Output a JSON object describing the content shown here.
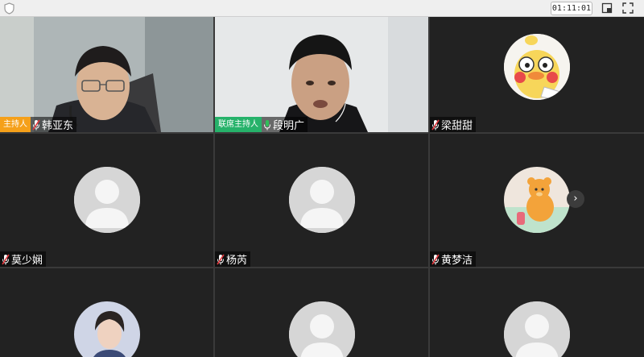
{
  "toolbar": {
    "timer": "01:11:01",
    "icons": [
      "shield-icon",
      "window-mode-icon",
      "fullscreen-icon"
    ]
  },
  "participants": [
    {
      "name": "韩亚东",
      "role": "主持人",
      "video": true,
      "mic": "muted"
    },
    {
      "name": "段明广",
      "role": "联席主持人",
      "video": true,
      "mic": "active",
      "speaking": true
    },
    {
      "name": "梁甜甜",
      "role": "",
      "video": false,
      "avatar": "duck-cartoon-avatar",
      "mic": "muted"
    },
    {
      "name": "莫少娴",
      "role": "",
      "video": false,
      "avatar": "default-avatar",
      "mic": "muted"
    },
    {
      "name": "杨芮",
      "role": "",
      "video": false,
      "avatar": "default-avatar",
      "mic": "muted"
    },
    {
      "name": "黄梦洁",
      "role": "",
      "video": false,
      "avatar": "bear-cartoon-avatar",
      "mic": "muted"
    },
    {
      "name": "",
      "role": "",
      "video": false,
      "avatar": "photo-avatar"
    },
    {
      "name": "",
      "role": "",
      "video": false,
      "avatar": "default-avatar"
    },
    {
      "name": "",
      "role": "",
      "video": false,
      "avatar": "default-avatar"
    }
  ],
  "colors": {
    "host_badge": "#f5a01a",
    "cohost_badge": "#26b26a",
    "tile_bg": "#222222",
    "active_border": "#27306e",
    "mic_muted": "#e0393e",
    "mic_active": "#2fbf59"
  }
}
